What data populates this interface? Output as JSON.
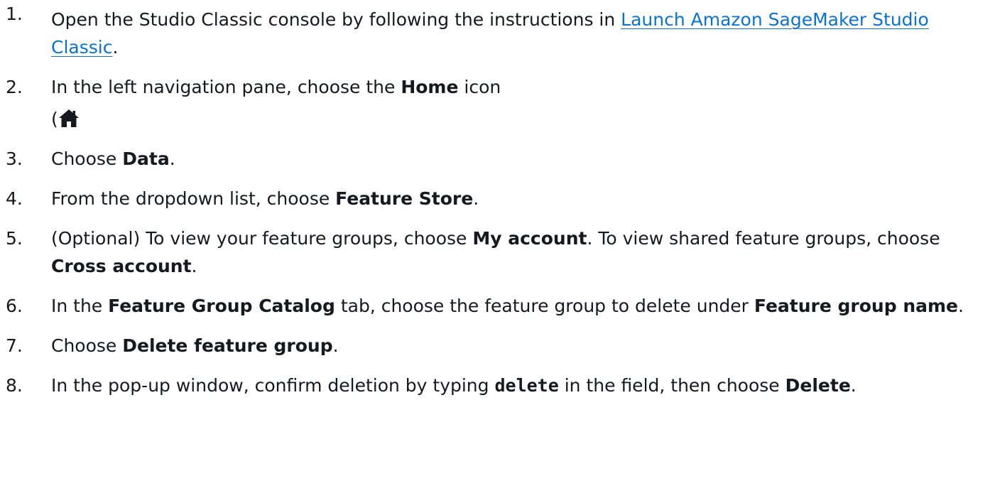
{
  "steps": [
    {
      "number": "1.",
      "text_before": "Open the Studio Classic console by following the instructions in ",
      "link": "Launch Amazon SageMaker Studio Classic",
      "text_after": "."
    },
    {
      "number": "2.",
      "text_before": "In the left navigation pane, choose the ",
      "bold": "Home",
      "text_after": " icon",
      "paren": "(",
      "icon": "home-icon"
    },
    {
      "number": "3.",
      "text_before": "Choose ",
      "bold": "Data",
      "text_after": "."
    },
    {
      "number": "4.",
      "text_before": "From the dropdown list, choose ",
      "bold": "Feature Store",
      "text_after": "."
    },
    {
      "number": "5.",
      "text_before": "(Optional) To view your feature groups, choose ",
      "bold1": "My account",
      "text_middle": ". To view shared feature groups, choose ",
      "bold2": "Cross account",
      "text_after": "."
    },
    {
      "number": "6.",
      "text_before": "In the ",
      "bold1": "Feature Group Catalog",
      "text_middle": " tab, choose the feature group to delete under ",
      "bold2": "Feature group name",
      "text_after": "."
    },
    {
      "number": "7.",
      "text_before": "Choose ",
      "bold": "Delete feature group",
      "text_after": "."
    },
    {
      "number": "8.",
      "text_before": "In the pop-up window, confirm deletion by typing ",
      "code": "delete",
      "text_middle": " in the field, then choose ",
      "bold": "Delete",
      "text_after": "."
    }
  ],
  "colors": {
    "text": "#16191f",
    "link": "#0972d3",
    "background": "#ffffff"
  }
}
